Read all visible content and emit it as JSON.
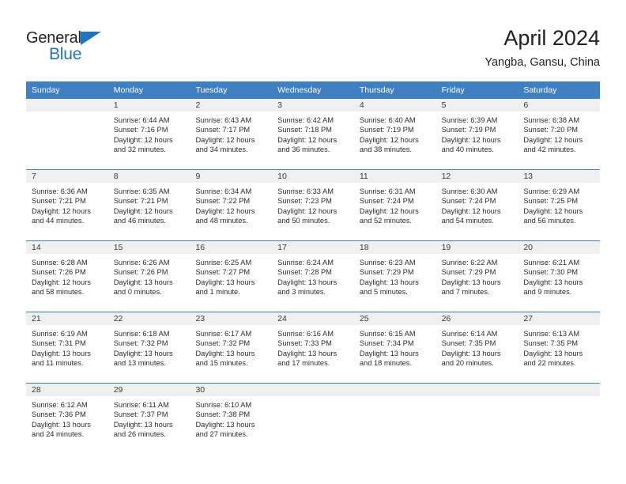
{
  "brand": {
    "name_top": "General",
    "name_bottom": "Blue",
    "triangle_color": "#1f74bd",
    "text_color": "#231f20"
  },
  "header": {
    "title": "April 2024",
    "subtitle": "Yangba, Gansu, China"
  },
  "theme": {
    "header_blue": "#3f80c2",
    "daynum_band": "#f0f0f0",
    "text": "#2d2d2d"
  },
  "weekdays": [
    "Sunday",
    "Monday",
    "Tuesday",
    "Wednesday",
    "Thursday",
    "Friday",
    "Saturday"
  ],
  "weeks": [
    [
      {
        "empty": true
      },
      {
        "day": "1",
        "sunrise": "Sunrise: 6:44 AM",
        "sunset": "Sunset: 7:16 PM",
        "daylight1": "Daylight: 12 hours",
        "daylight2": "and 32 minutes."
      },
      {
        "day": "2",
        "sunrise": "Sunrise: 6:43 AM",
        "sunset": "Sunset: 7:17 PM",
        "daylight1": "Daylight: 12 hours",
        "daylight2": "and 34 minutes."
      },
      {
        "day": "3",
        "sunrise": "Sunrise: 6:42 AM",
        "sunset": "Sunset: 7:18 PM",
        "daylight1": "Daylight: 12 hours",
        "daylight2": "and 36 minutes."
      },
      {
        "day": "4",
        "sunrise": "Sunrise: 6:40 AM",
        "sunset": "Sunset: 7:19 PM",
        "daylight1": "Daylight: 12 hours",
        "daylight2": "and 38 minutes."
      },
      {
        "day": "5",
        "sunrise": "Sunrise: 6:39 AM",
        "sunset": "Sunset: 7:19 PM",
        "daylight1": "Daylight: 12 hours",
        "daylight2": "and 40 minutes."
      },
      {
        "day": "6",
        "sunrise": "Sunrise: 6:38 AM",
        "sunset": "Sunset: 7:20 PM",
        "daylight1": "Daylight: 12 hours",
        "daylight2": "and 42 minutes."
      }
    ],
    [
      {
        "day": "7",
        "sunrise": "Sunrise: 6:36 AM",
        "sunset": "Sunset: 7:21 PM",
        "daylight1": "Daylight: 12 hours",
        "daylight2": "and 44 minutes."
      },
      {
        "day": "8",
        "sunrise": "Sunrise: 6:35 AM",
        "sunset": "Sunset: 7:21 PM",
        "daylight1": "Daylight: 12 hours",
        "daylight2": "and 46 minutes."
      },
      {
        "day": "9",
        "sunrise": "Sunrise: 6:34 AM",
        "sunset": "Sunset: 7:22 PM",
        "daylight1": "Daylight: 12 hours",
        "daylight2": "and 48 minutes."
      },
      {
        "day": "10",
        "sunrise": "Sunrise: 6:33 AM",
        "sunset": "Sunset: 7:23 PM",
        "daylight1": "Daylight: 12 hours",
        "daylight2": "and 50 minutes."
      },
      {
        "day": "11",
        "sunrise": "Sunrise: 6:31 AM",
        "sunset": "Sunset: 7:24 PM",
        "daylight1": "Daylight: 12 hours",
        "daylight2": "and 52 minutes."
      },
      {
        "day": "12",
        "sunrise": "Sunrise: 6:30 AM",
        "sunset": "Sunset: 7:24 PM",
        "daylight1": "Daylight: 12 hours",
        "daylight2": "and 54 minutes."
      },
      {
        "day": "13",
        "sunrise": "Sunrise: 6:29 AM",
        "sunset": "Sunset: 7:25 PM",
        "daylight1": "Daylight: 12 hours",
        "daylight2": "and 56 minutes."
      }
    ],
    [
      {
        "day": "14",
        "sunrise": "Sunrise: 6:28 AM",
        "sunset": "Sunset: 7:26 PM",
        "daylight1": "Daylight: 12 hours",
        "daylight2": "and 58 minutes."
      },
      {
        "day": "15",
        "sunrise": "Sunrise: 6:26 AM",
        "sunset": "Sunset: 7:26 PM",
        "daylight1": "Daylight: 13 hours",
        "daylight2": "and 0 minutes."
      },
      {
        "day": "16",
        "sunrise": "Sunrise: 6:25 AM",
        "sunset": "Sunset: 7:27 PM",
        "daylight1": "Daylight: 13 hours",
        "daylight2": "and 1 minute."
      },
      {
        "day": "17",
        "sunrise": "Sunrise: 6:24 AM",
        "sunset": "Sunset: 7:28 PM",
        "daylight1": "Daylight: 13 hours",
        "daylight2": "and 3 minutes."
      },
      {
        "day": "18",
        "sunrise": "Sunrise: 6:23 AM",
        "sunset": "Sunset: 7:29 PM",
        "daylight1": "Daylight: 13 hours",
        "daylight2": "and 5 minutes."
      },
      {
        "day": "19",
        "sunrise": "Sunrise: 6:22 AM",
        "sunset": "Sunset: 7:29 PM",
        "daylight1": "Daylight: 13 hours",
        "daylight2": "and 7 minutes."
      },
      {
        "day": "20",
        "sunrise": "Sunrise: 6:21 AM",
        "sunset": "Sunset: 7:30 PM",
        "daylight1": "Daylight: 13 hours",
        "daylight2": "and 9 minutes."
      }
    ],
    [
      {
        "day": "21",
        "sunrise": "Sunrise: 6:19 AM",
        "sunset": "Sunset: 7:31 PM",
        "daylight1": "Daylight: 13 hours",
        "daylight2": "and 11 minutes."
      },
      {
        "day": "22",
        "sunrise": "Sunrise: 6:18 AM",
        "sunset": "Sunset: 7:32 PM",
        "daylight1": "Daylight: 13 hours",
        "daylight2": "and 13 minutes."
      },
      {
        "day": "23",
        "sunrise": "Sunrise: 6:17 AM",
        "sunset": "Sunset: 7:32 PM",
        "daylight1": "Daylight: 13 hours",
        "daylight2": "and 15 minutes."
      },
      {
        "day": "24",
        "sunrise": "Sunrise: 6:16 AM",
        "sunset": "Sunset: 7:33 PM",
        "daylight1": "Daylight: 13 hours",
        "daylight2": "and 17 minutes."
      },
      {
        "day": "25",
        "sunrise": "Sunrise: 6:15 AM",
        "sunset": "Sunset: 7:34 PM",
        "daylight1": "Daylight: 13 hours",
        "daylight2": "and 18 minutes."
      },
      {
        "day": "26",
        "sunrise": "Sunrise: 6:14 AM",
        "sunset": "Sunset: 7:35 PM",
        "daylight1": "Daylight: 13 hours",
        "daylight2": "and 20 minutes."
      },
      {
        "day": "27",
        "sunrise": "Sunrise: 6:13 AM",
        "sunset": "Sunset: 7:35 PM",
        "daylight1": "Daylight: 13 hours",
        "daylight2": "and 22 minutes."
      }
    ],
    [
      {
        "day": "28",
        "sunrise": "Sunrise: 6:12 AM",
        "sunset": "Sunset: 7:36 PM",
        "daylight1": "Daylight: 13 hours",
        "daylight2": "and 24 minutes."
      },
      {
        "day": "29",
        "sunrise": "Sunrise: 6:11 AM",
        "sunset": "Sunset: 7:37 PM",
        "daylight1": "Daylight: 13 hours",
        "daylight2": "and 26 minutes."
      },
      {
        "day": "30",
        "sunrise": "Sunrise: 6:10 AM",
        "sunset": "Sunset: 7:38 PM",
        "daylight1": "Daylight: 13 hours",
        "daylight2": "and 27 minutes."
      },
      {
        "empty": true
      },
      {
        "empty": true
      },
      {
        "empty": true
      },
      {
        "empty": true
      }
    ]
  ]
}
